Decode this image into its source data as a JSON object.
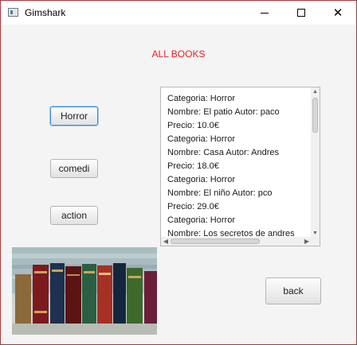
{
  "window": {
    "title": "Gimshark",
    "controls": {
      "minimize": "minimize-icon",
      "maximize": "maximize-icon",
      "close": "close-icon"
    }
  },
  "heading": {
    "text": "ALL BOOKS",
    "color": "#e0201c"
  },
  "genres": {
    "horror_label": "Horror",
    "comedi_label": "comedi",
    "action_label": "action"
  },
  "books_text": {
    "lines": [
      "Categoria: Horror",
      "Nombre: El patio  Autor: paco",
      "Precio: 10.0€",
      "Categoria: Horror",
      "Nombre: Casa  Autor: Andres",
      "Precio: 18.0€",
      "Categoria: Horror",
      "Nombre: El niño  Autor: pco",
      "Precio: 29.0€",
      "Categoria: Horror",
      "Nombre: Los secretos de andres"
    ]
  },
  "footer": {
    "back_label": "back"
  },
  "image": {
    "icon": "books-image"
  }
}
